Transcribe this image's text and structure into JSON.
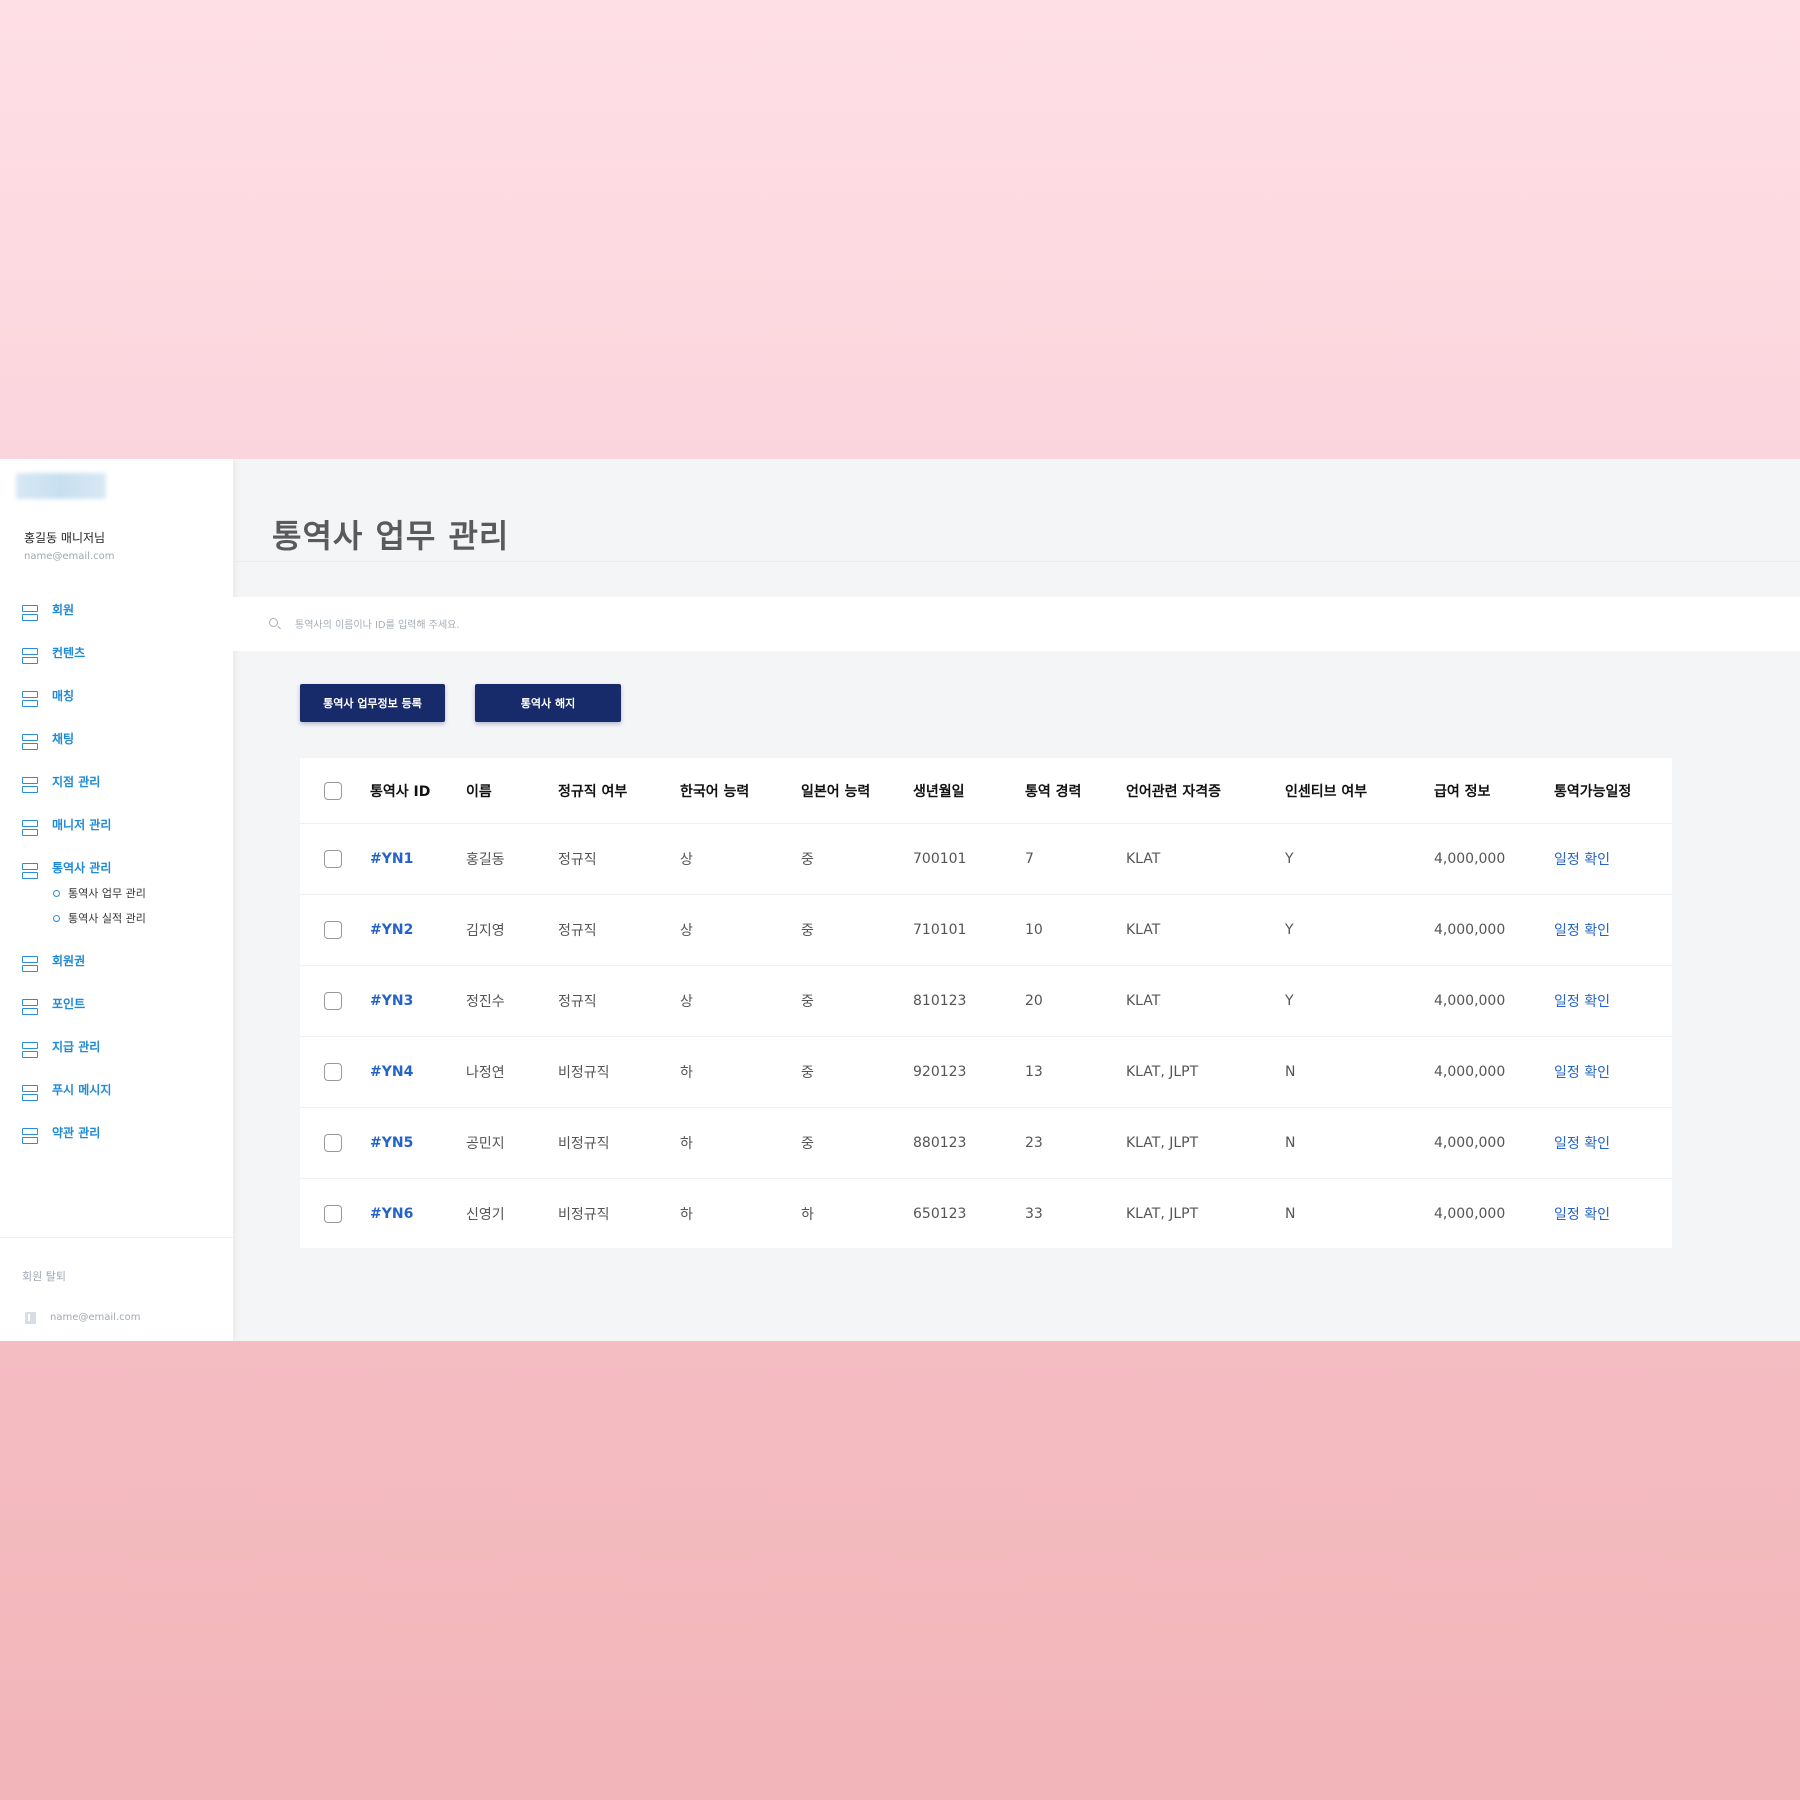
{
  "sidebar": {
    "user_name": "홍길동 매니저님",
    "user_email": "name@email.com",
    "items": [
      {
        "label": "회원"
      },
      {
        "label": "컨텐츠"
      },
      {
        "label": "매칭"
      },
      {
        "label": "채팅"
      },
      {
        "label": "지점 관리"
      },
      {
        "label": "매니저 관리"
      },
      {
        "label": "통역사 관리"
      },
      {
        "label": "회원권"
      },
      {
        "label": "포인트"
      },
      {
        "label": "지급 관리"
      },
      {
        "label": "푸시 메시지"
      },
      {
        "label": "약관 관리"
      }
    ],
    "sub_items": [
      {
        "label": "통역사 업무 관리"
      },
      {
        "label": "통역사 실적 관리"
      }
    ],
    "withdraw_label": "회원 탈퇴",
    "footer_email": "name@email.com"
  },
  "main": {
    "title": "통역사 업무 관리",
    "search_placeholder": "통역사의 이름이나 ID를 입력해 주세요.",
    "buttons": {
      "register": "통역사 업무정보 등록",
      "terminate": "통역사 해지"
    },
    "table": {
      "headers": [
        "통역사 ID",
        "이름",
        "정규직 여부",
        "한국어 능력",
        "일본어 능력",
        "생년월일",
        "통역 경력",
        "언어관련 자격증",
        "인센티브 여부",
        "급여 정보",
        "통역가능일정"
      ],
      "rows": [
        [
          "#YN1",
          "홍길동",
          "정규직",
          "상",
          "중",
          "700101",
          "7",
          "KLAT",
          "Y",
          "4,000,000",
          "일정 확인"
        ],
        [
          "#YN2",
          "김지영",
          "정규직",
          "상",
          "중",
          "710101",
          "10",
          "KLAT",
          "Y",
          "4,000,000",
          "일정 확인"
        ],
        [
          "#YN3",
          "정진수",
          "정규직",
          "상",
          "중",
          "810123",
          "20",
          "KLAT",
          "Y",
          "4,000,000",
          "일정 확인"
        ],
        [
          "#YN4",
          "나정연",
          "비정규직",
          "하",
          "중",
          "920123",
          "13",
          "KLAT, JLPT",
          "N",
          "4,000,000",
          "일정 확인"
        ],
        [
          "#YN5",
          "공민지",
          "비정규직",
          "하",
          "중",
          "880123",
          "23",
          "KLAT, JLPT",
          "N",
          "4,000,000",
          "일정 확인"
        ],
        [
          "#YN6",
          "신영기",
          "비정규직",
          "하",
          "하",
          "650123",
          "33",
          "KLAT, JLPT",
          "N",
          "4,000,000",
          "일정 확인"
        ]
      ]
    }
  },
  "colors": {
    "accent": "#1f8bd6",
    "button": "#172b6b",
    "link": "#2563c9"
  }
}
